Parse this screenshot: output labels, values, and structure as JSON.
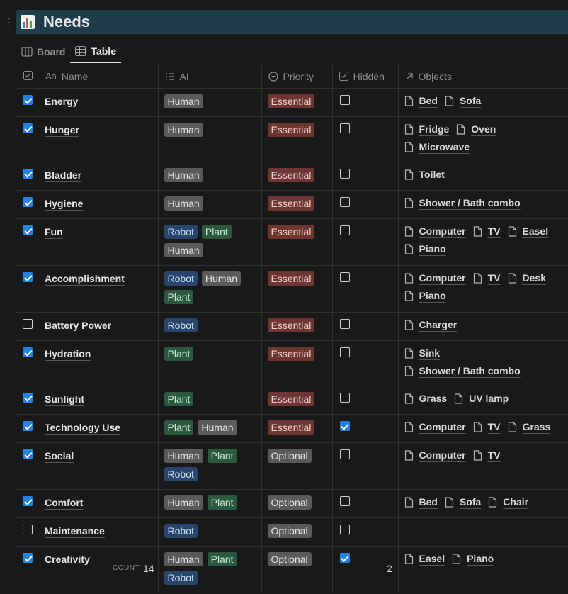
{
  "page": {
    "title": "Needs",
    "icon": "bar-chart-icon",
    "accent": "#1d3d4b"
  },
  "tabs": [
    {
      "label": "Board",
      "icon": "board-icon",
      "active": false
    },
    {
      "label": "Table",
      "icon": "table-icon",
      "active": true
    }
  ],
  "columns": {
    "name": {
      "prefix": "Aa",
      "label": "Name"
    },
    "ai": {
      "label": "AI",
      "icon": "list-icon"
    },
    "priority": {
      "label": "Priority",
      "icon": "select-icon"
    },
    "hidden": {
      "label": "Hidden",
      "icon": "checkbox-icon"
    },
    "objects": {
      "label": "Objects",
      "icon": "relation-arrow-icon"
    }
  },
  "colors": {
    "Human": "#5a5a5a",
    "Robot": "#28456c",
    "Plant": "#2b593f",
    "Essential": "#6e3630",
    "Optional": "#5a5a5a",
    "checkbox_on": "#2383e2"
  },
  "rows": [
    {
      "checked": true,
      "name": "Energy",
      "ai": [
        "Human"
      ],
      "priority": "Essential",
      "hidden": false,
      "objects": [
        "Bed",
        "Sofa"
      ]
    },
    {
      "checked": true,
      "name": "Hunger",
      "ai": [
        "Human"
      ],
      "priority": "Essential",
      "hidden": false,
      "objects": [
        "Fridge",
        "Oven",
        "Microwave"
      ]
    },
    {
      "checked": true,
      "name": "Bladder",
      "ai": [
        "Human"
      ],
      "priority": "Essential",
      "hidden": false,
      "objects": [
        "Toilet"
      ]
    },
    {
      "checked": true,
      "name": "Hygiene",
      "ai": [
        "Human"
      ],
      "priority": "Essential",
      "hidden": false,
      "objects": [
        "Shower / Bath combo"
      ]
    },
    {
      "checked": true,
      "name": "Fun",
      "ai": [
        "Robot",
        "Plant",
        "Human"
      ],
      "priority": "Essential",
      "hidden": false,
      "objects": [
        "Computer",
        "TV",
        "Easel",
        "Piano"
      ]
    },
    {
      "checked": true,
      "name": "Accomplishment",
      "ai": [
        "Robot",
        "Human",
        "Plant"
      ],
      "priority": "Essential",
      "hidden": false,
      "objects": [
        "Computer",
        "TV",
        "Desk",
        "Piano"
      ]
    },
    {
      "checked": false,
      "name": "Battery Power",
      "ai": [
        "Robot"
      ],
      "priority": "Essential",
      "hidden": false,
      "objects": [
        "Charger"
      ]
    },
    {
      "checked": true,
      "name": "Hydration",
      "ai": [
        "Plant"
      ],
      "priority": "Essential",
      "hidden": false,
      "objects": [
        "Sink",
        "Shower / Bath combo"
      ]
    },
    {
      "checked": true,
      "name": "Sunlight",
      "ai": [
        "Plant"
      ],
      "priority": "Essential",
      "hidden": false,
      "objects": [
        "Grass",
        "UV lamp"
      ]
    },
    {
      "checked": true,
      "name": "Technology Use",
      "ai": [
        "Plant",
        "Human"
      ],
      "priority": "Essential",
      "hidden": true,
      "objects": [
        "Computer",
        "TV",
        "Grass"
      ]
    },
    {
      "checked": true,
      "name": "Social",
      "ai": [
        "Human",
        "Plant",
        "Robot"
      ],
      "priority": "Optional",
      "hidden": false,
      "objects": [
        "Computer",
        "TV"
      ]
    },
    {
      "checked": true,
      "name": "Comfort",
      "ai": [
        "Human",
        "Plant"
      ],
      "priority": "Optional",
      "hidden": false,
      "objects": [
        "Bed",
        "Sofa",
        "Chair"
      ]
    },
    {
      "checked": false,
      "name": "Maintenance",
      "ai": [
        "Robot"
      ],
      "priority": "Optional",
      "hidden": false,
      "objects": []
    },
    {
      "checked": true,
      "name": "Creativity",
      "ai": [
        "Human",
        "Plant",
        "Robot"
      ],
      "priority": "Optional",
      "hidden": true,
      "objects": [
        "Easel",
        "Piano"
      ]
    }
  ],
  "footer": {
    "count_label": "COUNT",
    "count_value": "14",
    "hidden_checked": "2"
  }
}
